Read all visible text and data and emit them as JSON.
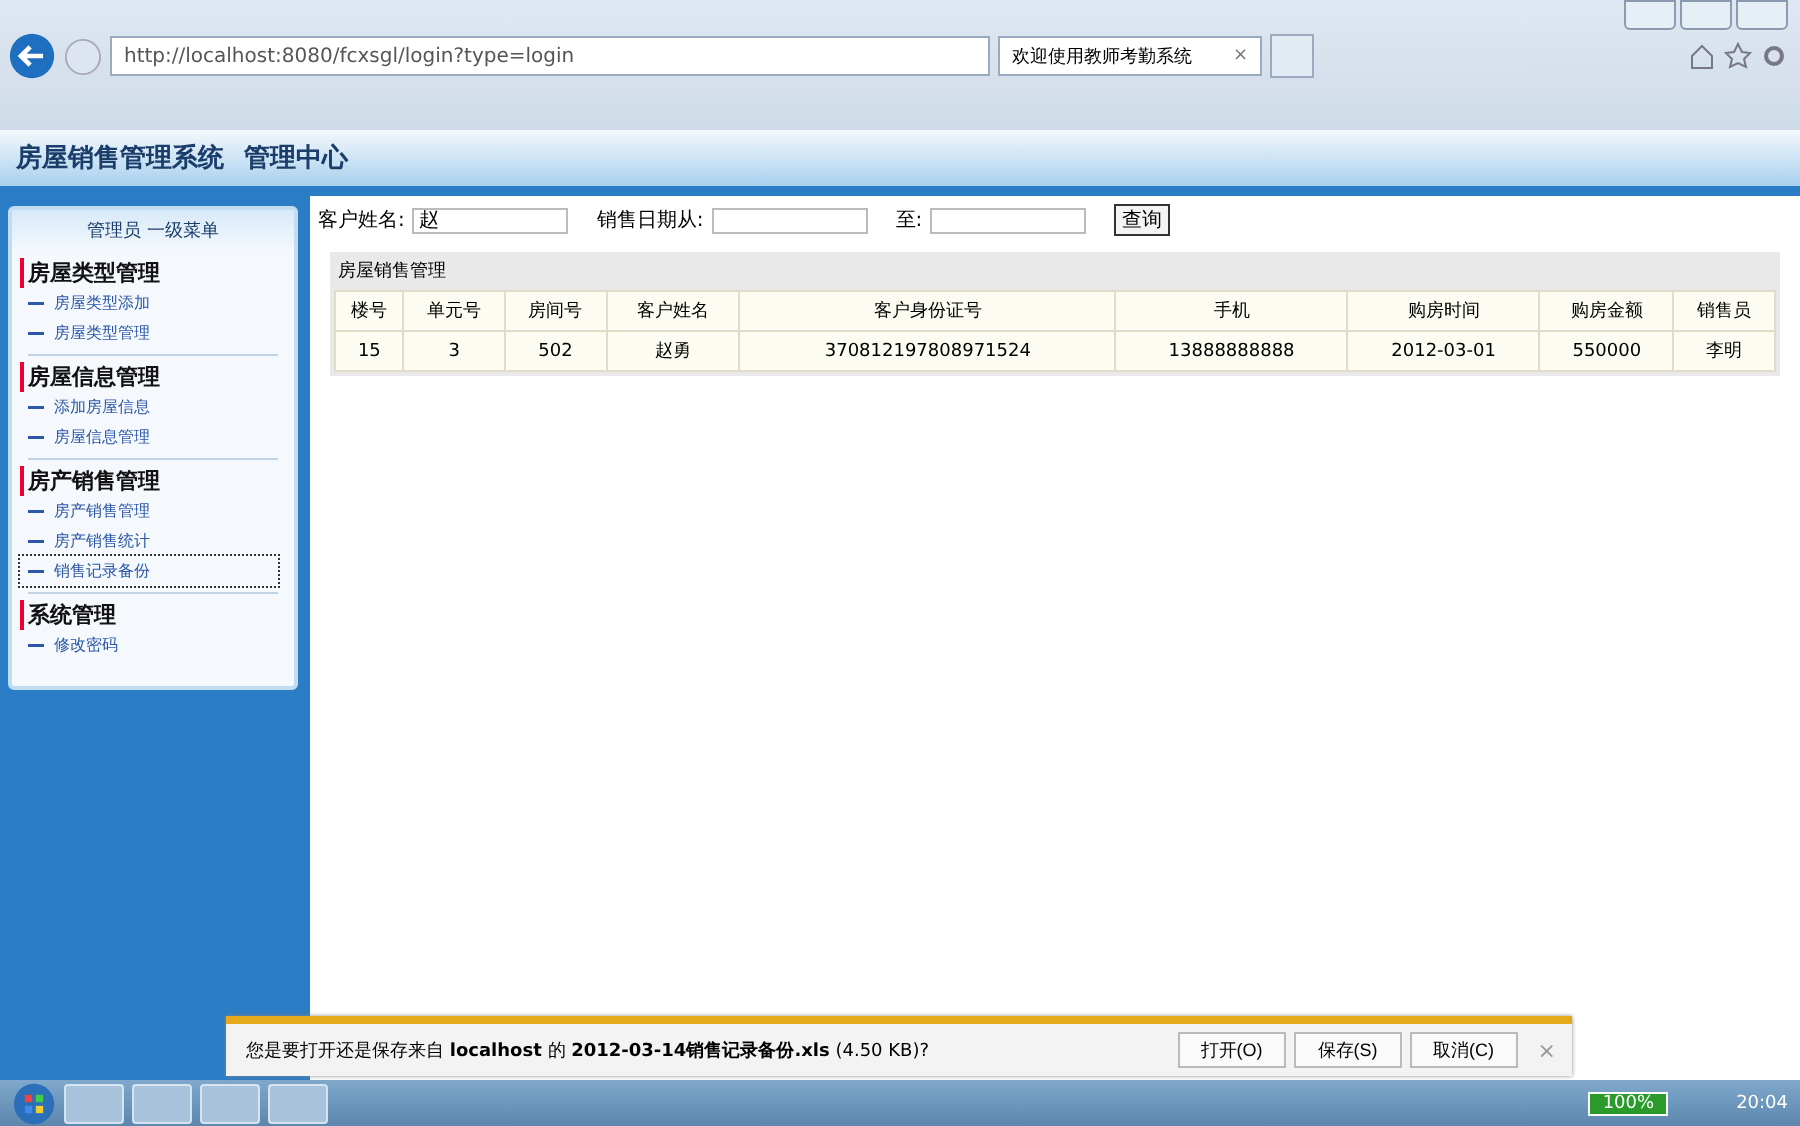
{
  "browser": {
    "url": "http://localhost:8080/fcxsgl/login?type=login",
    "tab_title": "欢迎使用教师考勤系统",
    "tab_close": "×"
  },
  "header": {
    "title": "房屋销售管理系统",
    "subtitle": "管理中心"
  },
  "sidebar": {
    "title": "管理员 一级菜单",
    "groups": [
      {
        "label": "房屋类型管理",
        "items": [
          {
            "label": "房屋类型添加",
            "selected": false
          },
          {
            "label": "房屋类型管理",
            "selected": false
          }
        ]
      },
      {
        "label": "房屋信息管理",
        "items": [
          {
            "label": "添加房屋信息",
            "selected": false
          },
          {
            "label": "房屋信息管理",
            "selected": false
          }
        ]
      },
      {
        "label": "房产销售管理",
        "items": [
          {
            "label": "房产销售管理",
            "selected": false
          },
          {
            "label": "房产销售统计",
            "selected": false
          },
          {
            "label": "销售记录备份",
            "selected": true
          }
        ]
      },
      {
        "label": "系统管理",
        "items": [
          {
            "label": "修改密码",
            "selected": false
          }
        ]
      }
    ]
  },
  "search": {
    "name_label": "客户姓名:",
    "name_value": "赵",
    "from_label": "销售日期从:",
    "to_label": "至:",
    "button": "查询"
  },
  "table": {
    "title": "房屋销售管理",
    "columns": [
      "楼号",
      "单元号",
      "房间号",
      "客户姓名",
      "客户身份证号",
      "手机",
      "购房时间",
      "购房金额",
      "销售员"
    ],
    "rows": [
      [
        "15",
        "3",
        "502",
        "赵勇",
        "370812197808971524",
        "13888888888",
        "2012-03-01",
        "550000",
        "李明"
      ]
    ]
  },
  "download_bar": {
    "message": "您是要打开还是保存来自 **localhost** 的 **2012-03-14销售记录备份.xls** (4.50 KB)?",
    "buttons": [
      "打开(O)",
      "保存(S)",
      "取消(C)"
    ],
    "close": "×"
  },
  "taskbar": {
    "battery": "100%",
    "clock": "20:04"
  }
}
